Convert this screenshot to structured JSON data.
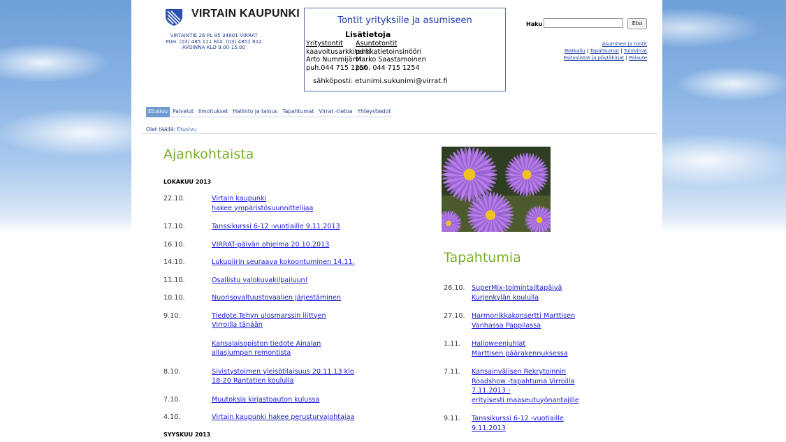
{
  "header": {
    "brand": "VIRTAIN KAUPUNKI",
    "address_lines": [
      "VIRTAINTIE 26  PL 85  34801 VIRRAT",
      "PUH. (03) 485 111   FAX. (03) 4851 612",
      "AVOINNA KLO 9.00-15.00"
    ],
    "logo_icon": "coat-of-arms-icon"
  },
  "promo": {
    "title": "Tontit yrityksille ja asumiseen",
    "subtitle": "Lisätietoja",
    "col1": [
      "Yritystontit",
      "kaavoitusarkkitehti",
      "Arto Nummijärvi",
      "puh.044 715 1250"
    ],
    "col2": [
      "Asuntotontit",
      "paikkatietoinsinööri",
      "Marko Saastamoinen",
      "puh. 044 715 1254"
    ],
    "email": "sähköposti: etunimi.sukunimi@virrat.fi"
  },
  "search": {
    "label": "Haku",
    "value": "",
    "placeholder": "",
    "button": "Etsi"
  },
  "quick_links": {
    "line1": "Asuminen ja tontit",
    "line2": [
      "Matkailu",
      "Tapahtumat",
      "TuloVirrat"
    ],
    "line3": [
      "Esityslistat ja pöytäkirjat",
      "Palaute"
    ],
    "separator": "|"
  },
  "nav": [
    "Etusivu",
    "Palvelut",
    "Ilmoitukset",
    "Hallinto ja talous",
    "Tapahtumat",
    "Virrat -tietoa",
    "Yhteystiedot"
  ],
  "breadcrumb": {
    "label": "Olet täällä:",
    "current": "Etusivu"
  },
  "news": {
    "heading": "Ajankohtaista",
    "month": "LOKAKUU 2013",
    "items": [
      {
        "date": "22.10.",
        "lines": [
          "Virtain kaupunki",
          "hakee ympäristösuunnittelijaa"
        ]
      },
      {
        "date": "17.10.",
        "lines": [
          "Tanssikurssi 6-12 -vuotiaille 9.11.2013"
        ]
      },
      {
        "date": "16.10.",
        "lines": [
          "VIRRAT-päivän ohjelma 20.10.2013"
        ]
      },
      {
        "date": "14.10.",
        "lines": [
          "Lukupiirin seuraava kokoontuminen 14.11."
        ]
      },
      {
        "date": "11.10.",
        "lines": [
          "Osallistu valokuvakilpailuun!"
        ]
      },
      {
        "date": "10.10.",
        "lines": [
          "Nuorisovaltuustovaalien järjestäminen"
        ]
      },
      {
        "date": "9.10.",
        "lines": [
          "Tiedote Tehyn ulosmarssin liittyen",
          "Virroilla tänään"
        ]
      },
      {
        "date": "",
        "lines": [
          "Kansalaisopiston tiedote Ainalan",
          "allasjumpan remontista"
        ]
      },
      {
        "date": "8.10.",
        "lines": [
          "Sivistystoimen yleisötilaisuus 20.11.13 klo",
          "18-20 Rantatien koululla"
        ]
      },
      {
        "date": "7.10.",
        "lines": [
          "Muutoksia kirjastoauton kulussa"
        ]
      },
      {
        "date": "4.10.",
        "lines": [
          "Virtain kaupunki hakee perusturvajohtajaa"
        ]
      }
    ],
    "next_month": "SYYSKUU 2013"
  },
  "events": {
    "heading": "Tapahtumia",
    "items": [
      {
        "date": "26.10.",
        "lines": [
          "SuperMix-toimintailtapäivä",
          "Kurjenkylän koululla"
        ]
      },
      {
        "date": "27.10.",
        "lines": [
          "Harmonikkakonsertti Marttisen",
          "Vanhassa Pappilassa"
        ]
      },
      {
        "date": "1.11.",
        "lines": [
          "Halloweenjuhlat",
          "Marttisen päärakennuksessa"
        ]
      },
      {
        "date": "7.11.",
        "lines": [
          "Kansainvälisen Rekrytoinnin",
          "Roadshow -tapahtuma Virroilla",
          "7.11.2013 -",
          "erityisesti maaseutuyönantajille"
        ]
      },
      {
        "date": "9.11.",
        "lines": [
          "Tanssikurssi 6-12 -vuotiaille",
          "9.11.2013"
        ]
      }
    ]
  },
  "colors": {
    "heading_green": "#79b026",
    "link_blue": "#1a1ad6",
    "nav_active": "#6f9bd2"
  }
}
